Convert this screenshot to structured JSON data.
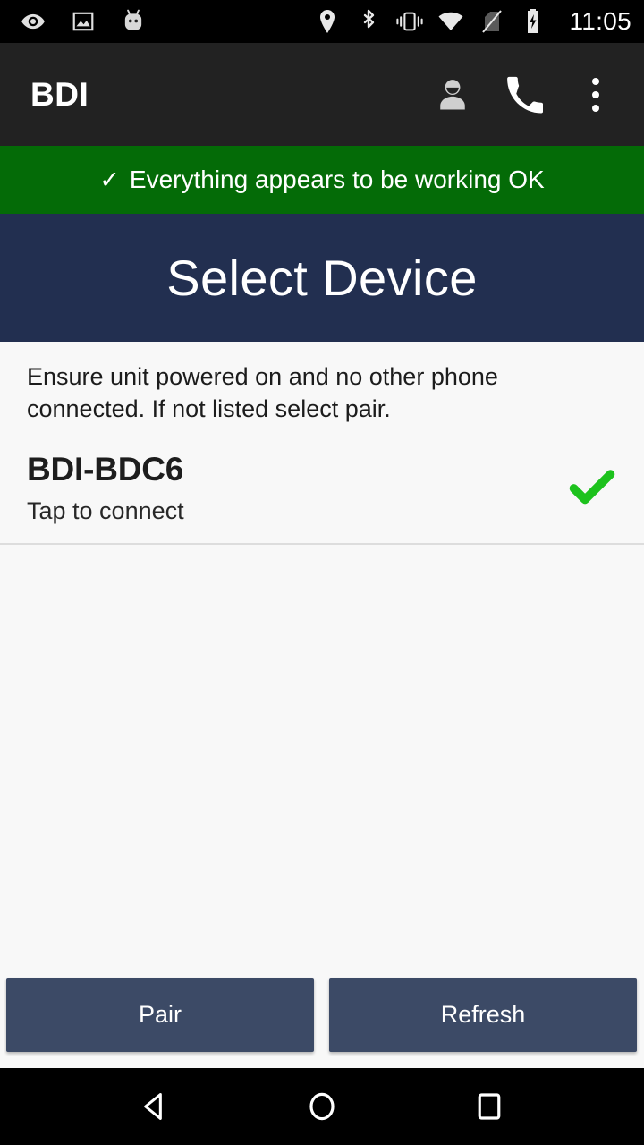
{
  "status_bar": {
    "time": "11:05",
    "left_icons": [
      {
        "name": "eye-icon"
      },
      {
        "name": "image-icon"
      },
      {
        "name": "cyanogenmod-icon"
      }
    ],
    "right_icons": [
      {
        "name": "location-icon"
      },
      {
        "name": "bluetooth-icon"
      },
      {
        "name": "vibrate-icon"
      },
      {
        "name": "wifi-icon"
      },
      {
        "name": "no-sim-icon"
      },
      {
        "name": "battery-charging-icon"
      }
    ]
  },
  "app_bar": {
    "title": "BDI",
    "actions": [
      {
        "name": "account-icon"
      },
      {
        "name": "phone-icon"
      },
      {
        "name": "overflow-menu-icon"
      }
    ]
  },
  "status_banner": {
    "check": "✓",
    "text": "Everything appears to be working OK",
    "background": "#046b07"
  },
  "page_header": {
    "title": "Select Device",
    "background": "#222f50"
  },
  "content": {
    "instructions": "Ensure unit powered on and no other phone connected. If not listed select pair.",
    "devices": [
      {
        "name": "BDI-BDC6",
        "subtitle": "Tap to connect",
        "status_icon": "check-icon",
        "status_color": "#1dc21d"
      }
    ]
  },
  "buttons": {
    "pair_label": "Pair",
    "refresh_label": "Refresh",
    "color": "#3c4a66"
  },
  "nav_bar": {
    "back": "back-icon",
    "home": "home-icon",
    "recents": "recents-icon"
  }
}
